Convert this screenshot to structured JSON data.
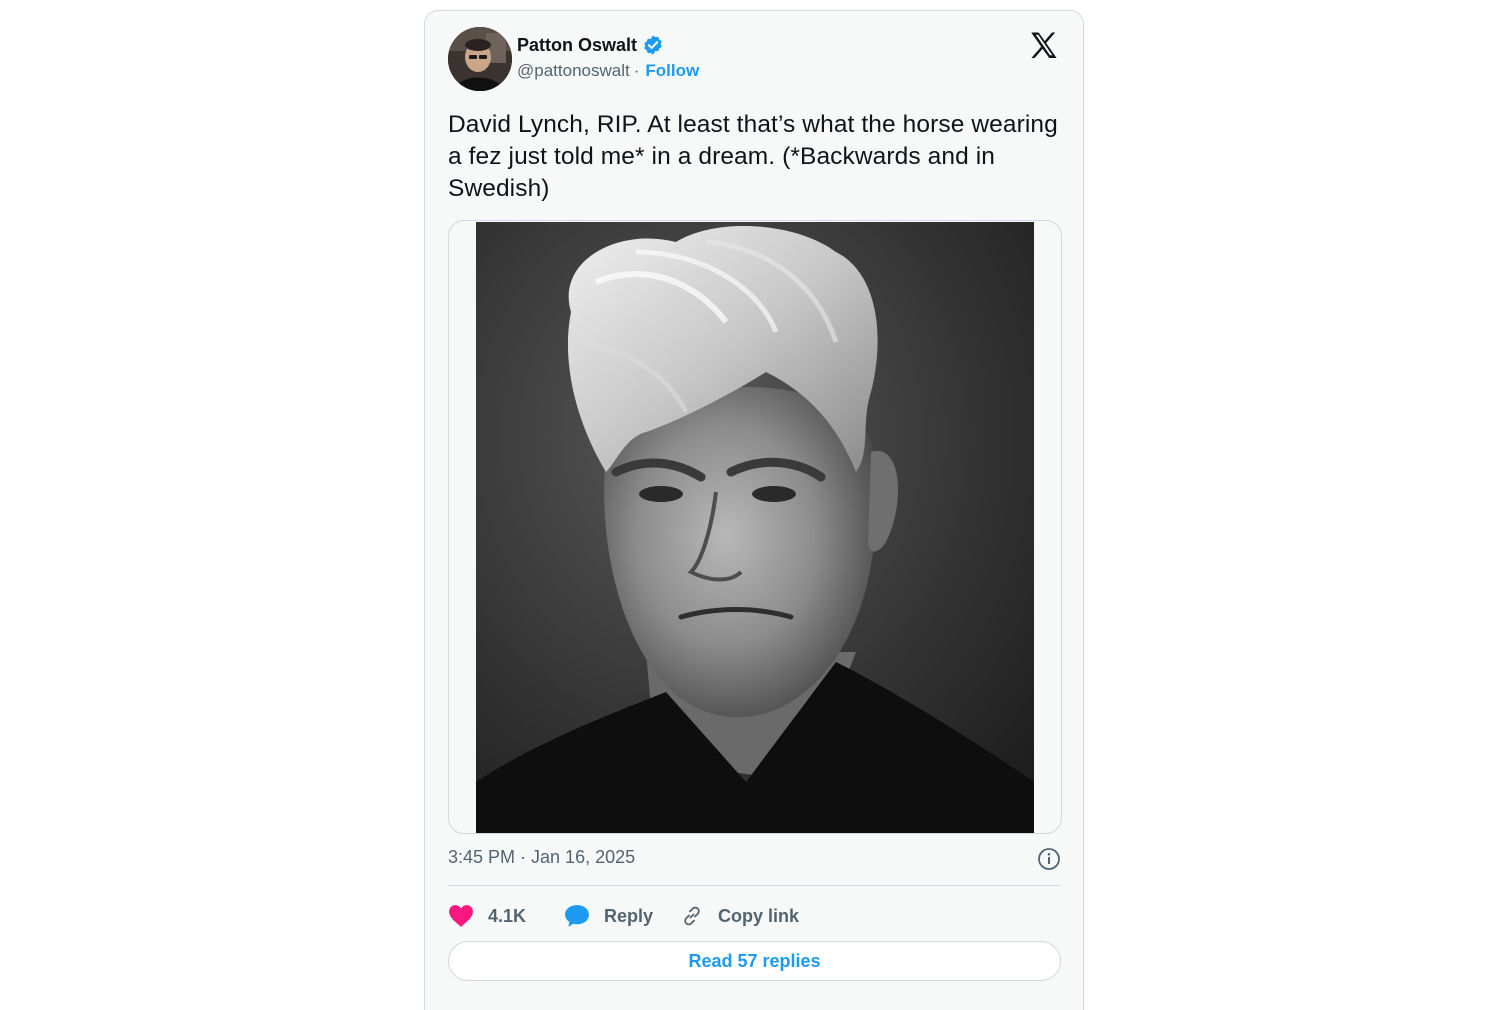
{
  "author": {
    "display_name": "Patton Oswalt",
    "handle": "@pattonoswalt",
    "separator": "·",
    "follow_label": "Follow",
    "verified_icon": "verified-badge-icon",
    "avatar_icon": "avatar"
  },
  "tweet": {
    "text": "David Lynch, RIP. At least that’s what the horse wearing a fez just told me* in a dream. (*Backwards and in Swedish)",
    "timestamp": "3:45 PM · Jan 16, 2025"
  },
  "actions": {
    "like_count": "4.1K",
    "reply_label": "Reply",
    "copy_link_label": "Copy link",
    "read_replies_label": "Read 57 replies"
  },
  "icons": {
    "brand": "x-logo-icon",
    "like": "heart-icon",
    "reply": "speech-bubble-icon",
    "copy": "link-icon",
    "info": "info-icon"
  },
  "colors": {
    "accent": "#1d9bf0",
    "like": "#f91880",
    "text": "#0f1419",
    "muted": "#536471",
    "border": "#cfd9de",
    "card_background": "#f7f9f9"
  }
}
